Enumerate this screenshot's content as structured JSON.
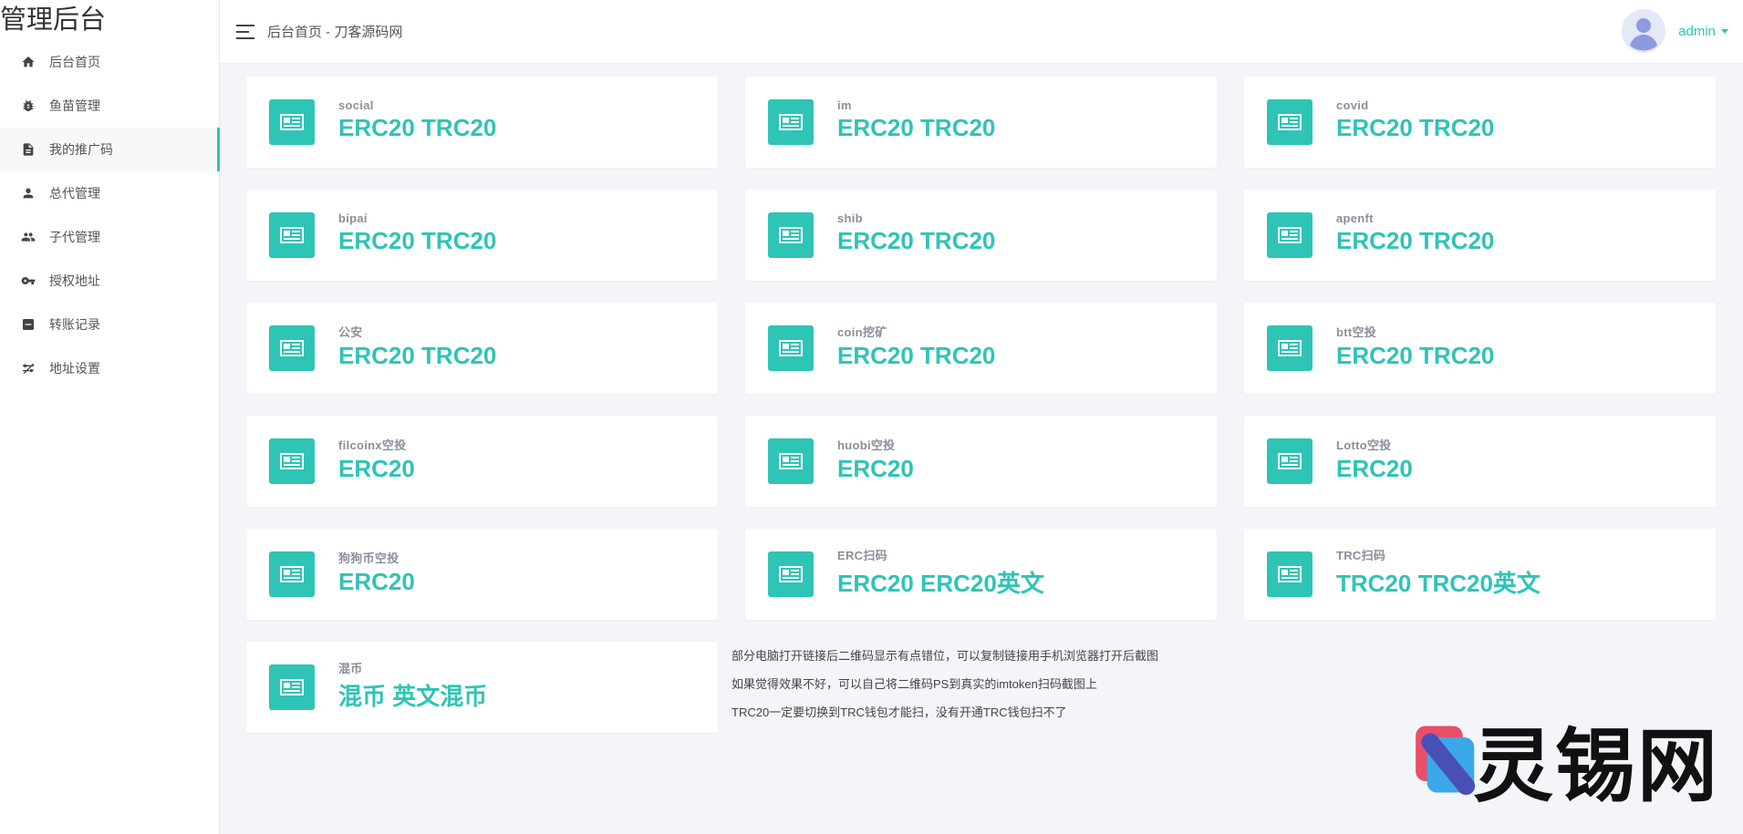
{
  "sidebar": {
    "brand": "管理后台",
    "items": [
      {
        "label": "后台首页",
        "icon": "home-icon"
      },
      {
        "label": "鱼苗管理",
        "icon": "bug-icon"
      },
      {
        "label": "我的推广码",
        "icon": "document-icon"
      },
      {
        "label": "总代管理",
        "icon": "person-icon"
      },
      {
        "label": "子代管理",
        "icon": "people-icon"
      },
      {
        "label": "授权地址",
        "icon": "key-icon"
      },
      {
        "label": "转账记录",
        "icon": "record-icon"
      },
      {
        "label": "地址设置",
        "icon": "settings-icon"
      }
    ],
    "active_index": 2,
    "accent_color": "#2ec4b6"
  },
  "header": {
    "title": "后台首页 - 刀客源码网",
    "user": "admin"
  },
  "cards": [
    {
      "label": "social",
      "value": "ERC20 TRC20"
    },
    {
      "label": "im",
      "value": "ERC20 TRC20"
    },
    {
      "label": "covid",
      "value": "ERC20 TRC20"
    },
    {
      "label": "bipai",
      "value": "ERC20 TRC20"
    },
    {
      "label": "shib",
      "value": "ERC20 TRC20"
    },
    {
      "label": "apenft",
      "value": "ERC20 TRC20"
    },
    {
      "label": "公安",
      "value": "ERC20 TRC20"
    },
    {
      "label": "coin挖矿",
      "value": "ERC20 TRC20"
    },
    {
      "label": "btt空投",
      "value": "ERC20 TRC20"
    },
    {
      "label": "filcoinx空投",
      "value": "ERC20"
    },
    {
      "label": "huobi空投",
      "value": "ERC20"
    },
    {
      "label": "Lotto空投",
      "value": "ERC20"
    },
    {
      "label": "狗狗币空投",
      "value": "ERC20"
    },
    {
      "label": "ERC扫码",
      "value": "ERC20 ERC20英文"
    },
    {
      "label": "TRC扫码",
      "value": "TRC20 TRC20英文"
    },
    {
      "label": "混币",
      "value": "混币 英文混币"
    }
  ],
  "notes": [
    "部分电脑打开链接后二维码显示有点错位，可以复制链接用手机浏览器打开后截图",
    "如果觉得效果不好，可以自己将二维码PS到真实的imtoken扫码截图上",
    "TRC20一定要切换到TRC钱包才能扫，没有开通TRC钱包扫不了"
  ],
  "watermark": {
    "text": "灵锡网"
  },
  "colors": {
    "accent": "#2ec4b6",
    "background": "#f4f5f9"
  }
}
